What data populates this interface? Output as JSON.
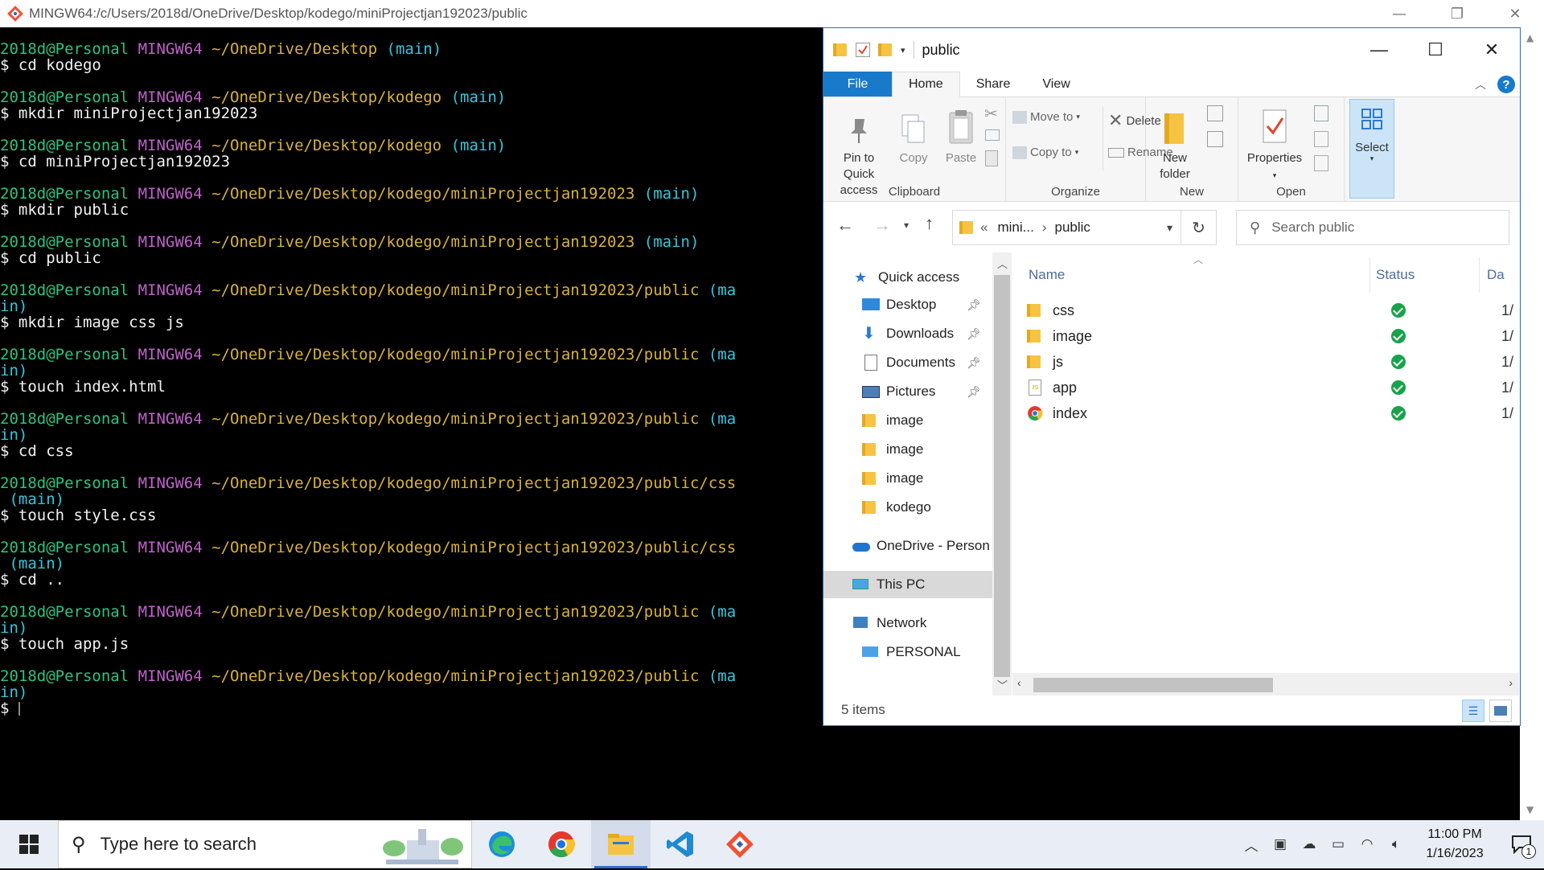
{
  "terminal": {
    "title": "MINGW64:/c/Users/2018d/OneDrive/Desktop/kodego/miniProjectjan192023/public",
    "window_buttons": [
      "—",
      "❐",
      "✕"
    ],
    "user": "2018d@Personal",
    "host": "MINGW64",
    "prompt_char": "$",
    "blocks": [
      {
        "path": "~/OneDrive/Desktop",
        "branch": "(main)",
        "branch_wrap": "",
        "cmd": "cd kodego"
      },
      {
        "path": "~/OneDrive/Desktop/kodego",
        "branch": "(main)",
        "branch_wrap": "",
        "cmd": "mkdir miniProjectjan192023"
      },
      {
        "path": "~/OneDrive/Desktop/kodego",
        "branch": "(main)",
        "branch_wrap": "",
        "cmd": "cd miniProjectjan192023"
      },
      {
        "path": "~/OneDrive/Desktop/kodego/miniProjectjan192023",
        "branch": "(main)",
        "branch_wrap": "",
        "cmd": "mkdir public"
      },
      {
        "path": "~/OneDrive/Desktop/kodego/miniProjectjan192023",
        "branch": "(main)",
        "branch_wrap": "",
        "cmd": "cd public"
      },
      {
        "path": "~/OneDrive/Desktop/kodego/miniProjectjan192023/public",
        "branch": "(ma",
        "branch_wrap": "in)",
        "cmd": "mkdir image css js"
      },
      {
        "path": "~/OneDrive/Desktop/kodego/miniProjectjan192023/public",
        "branch": "(ma",
        "branch_wrap": "in)",
        "cmd": "touch index.html"
      },
      {
        "path": "~/OneDrive/Desktop/kodego/miniProjectjan192023/public",
        "branch": "(ma",
        "branch_wrap": "in)",
        "cmd": "cd css"
      },
      {
        "path": "~/OneDrive/Desktop/kodego/miniProjectjan192023/public/css",
        "branch": "",
        "branch_wrap": " (main)",
        "cmd": "touch style.css"
      },
      {
        "path": "~/OneDrive/Desktop/kodego/miniProjectjan192023/public/css",
        "branch": "",
        "branch_wrap": " (main)",
        "cmd": "cd .."
      },
      {
        "path": "~/OneDrive/Desktop/kodego/miniProjectjan192023/public",
        "branch": "(ma",
        "branch_wrap": "in)",
        "cmd": "touch app.js"
      },
      {
        "path": "~/OneDrive/Desktop/kodego/miniProjectjan192023/public",
        "branch": "(ma",
        "branch_wrap": "in)",
        "cmd": ""
      }
    ]
  },
  "explorer": {
    "title": "public",
    "window_buttons": [
      "—",
      "☐",
      "✕"
    ],
    "tabs": [
      "File",
      "Home",
      "Share",
      "View"
    ],
    "ribbon": {
      "clipboard": {
        "label": "Clipboard",
        "pin": "Pin to Quick access",
        "copy": "Copy",
        "paste": "Paste"
      },
      "organize": {
        "label": "Organize",
        "move_to": "Move to",
        "copy_to": "Copy to",
        "delete": "Delete",
        "rename": "Rename"
      },
      "new": {
        "label": "New",
        "new_folder": "New folder"
      },
      "open": {
        "label": "Open",
        "properties": "Properties"
      },
      "select": {
        "label": "Select"
      }
    },
    "address": {
      "prefix": "«",
      "crumb1": "mini...",
      "sep": "›",
      "crumb2": "public"
    },
    "search_placeholder": "Search public",
    "nav": {
      "quick_access": "Quick access",
      "pinned": [
        "Desktop",
        "Downloads",
        "Documents",
        "Pictures"
      ],
      "recent": [
        "image",
        "image",
        "image",
        "kodego"
      ],
      "onedrive": "OneDrive - Person",
      "this_pc": "This PC",
      "network": "Network",
      "personal": "PERSONAL"
    },
    "columns": {
      "name": "Name",
      "status": "Status",
      "date": "Da"
    },
    "files": [
      {
        "name": "css",
        "type": "folder",
        "date": "1/"
      },
      {
        "name": "image",
        "type": "folder",
        "date": "1/"
      },
      {
        "name": "js",
        "type": "folder",
        "date": "1/"
      },
      {
        "name": "app",
        "type": "js-file",
        "date": "1/"
      },
      {
        "name": "index",
        "type": "chrome-html",
        "date": "1/"
      }
    ],
    "status_bar": "5 items"
  },
  "taskbar": {
    "search_placeholder": "Type here to search",
    "time": "11:00 PM",
    "date": "1/16/2023",
    "notification_count": "1",
    "apps": [
      "edge-icon",
      "chrome-icon",
      "file-explorer-icon",
      "vscode-icon",
      "git-bash-icon"
    ]
  },
  "colors": {
    "prompt_user": "#2ec27e",
    "prompt_host": "#c061cb",
    "prompt_path": "#d9b23b",
    "prompt_branch": "#33c7de",
    "accent": "#1979ca"
  }
}
